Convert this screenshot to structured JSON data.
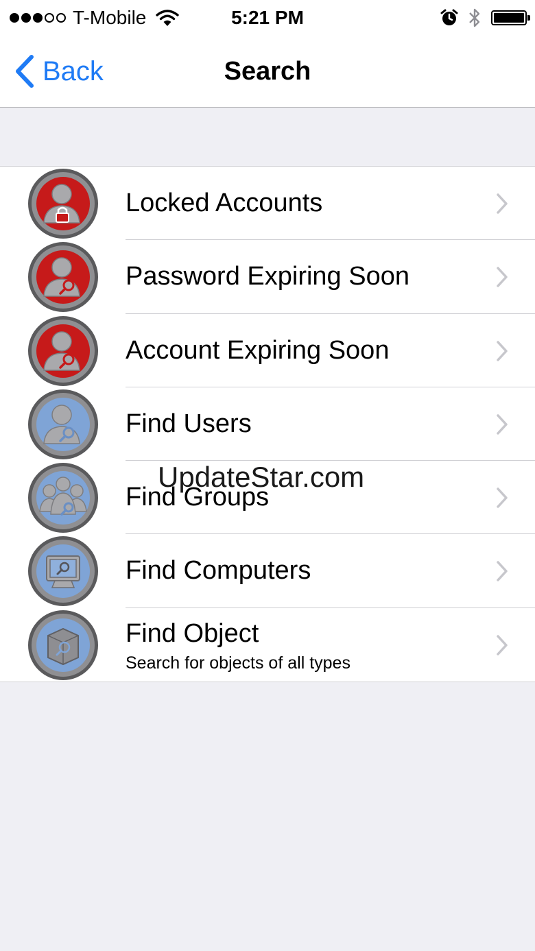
{
  "status_bar": {
    "carrier": "T-Mobile",
    "time": "5:21 PM",
    "signal_icon": "signal-dots-icon",
    "wifi_icon": "wifi-icon",
    "alarm_icon": "alarm-icon",
    "bluetooth_icon": "bluetooth-icon",
    "battery_icon": "battery-icon"
  },
  "nav": {
    "back_label": "Back",
    "title": "Search",
    "accent_color": "#1f7bf5"
  },
  "items": [
    {
      "title": "Locked Accounts",
      "icon": "locked-user-icon",
      "color": "red"
    },
    {
      "title": "Password Expiring Soon",
      "icon": "user-search-icon",
      "color": "red"
    },
    {
      "title": "Account Expiring Soon",
      "icon": "user-search-icon",
      "color": "red"
    },
    {
      "title": "Find Users",
      "icon": "user-search-icon",
      "color": "blue"
    },
    {
      "title": "Find Groups",
      "icon": "group-search-icon",
      "color": "blue"
    },
    {
      "title": "Find Computers",
      "icon": "computer-search-icon",
      "color": "blue"
    },
    {
      "title": "Find Object",
      "subtitle": "Search for objects of all types",
      "icon": "object-search-icon",
      "color": "blue"
    }
  ],
  "watermark": "UpdateStar.com"
}
